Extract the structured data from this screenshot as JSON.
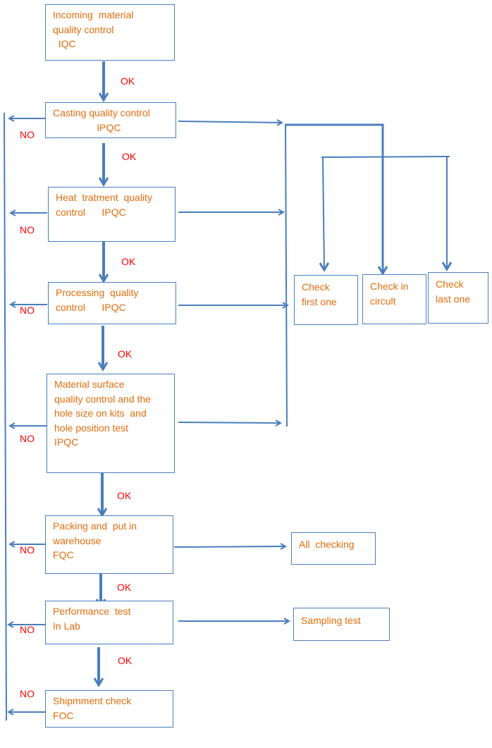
{
  "colors": {
    "line": "#4a7ebb",
    "box_text": "#e46c0a",
    "label": "#ff0000"
  },
  "steps": [
    {
      "id": "iqc",
      "text": "Incoming  material\nquality control\n  IQC"
    },
    {
      "id": "casting",
      "text": "Casting quality control\n                IPQC"
    },
    {
      "id": "heat",
      "text": "Heat  tratment  quality\ncontrol      IPQC"
    },
    {
      "id": "processing",
      "text": "Processing  quality\ncontrol      IPQC"
    },
    {
      "id": "surface",
      "text": "Material surface\nquality control and the\nhole size on kits  and\nhole position test\nIPQC"
    },
    {
      "id": "packing",
      "text": "Packing and  put in\nwarehouse\nFQC"
    },
    {
      "id": "performance",
      "text": "Performance  test\nIn Lab"
    },
    {
      "id": "shipment",
      "text": "Shipmment check\nFOC"
    }
  ],
  "checks": {
    "first": "Check\nfirst one",
    "circuit": "Check in\ncircult",
    "last": "Check\nlast one",
    "all": "All  checking",
    "sampling": "Sampling test"
  },
  "labels": {
    "ok": "OK",
    "no": "NO"
  }
}
